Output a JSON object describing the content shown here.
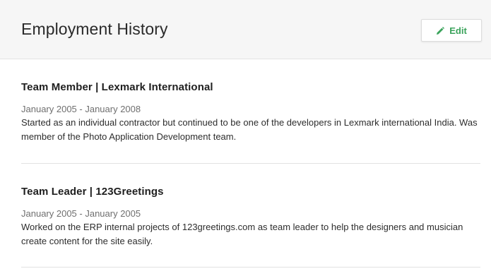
{
  "section": {
    "title": "Employment History",
    "edit_label": "Edit",
    "accent_color": "#3aa35b"
  },
  "entries": [
    {
      "title": "Team Member | Lexmark International",
      "dates": "January 2005 - January 2008",
      "description": "Started as an individual contractor but continued to be one of the developers in Lexmark international India. Was member of the Photo Application Development team."
    },
    {
      "title": "Team Leader | 123Greetings",
      "dates": "January 2005 - January 2005",
      "description": "Worked on the ERP internal projects of 123greetings.com as team leader to help the designers and musician create content for the site easily."
    }
  ]
}
